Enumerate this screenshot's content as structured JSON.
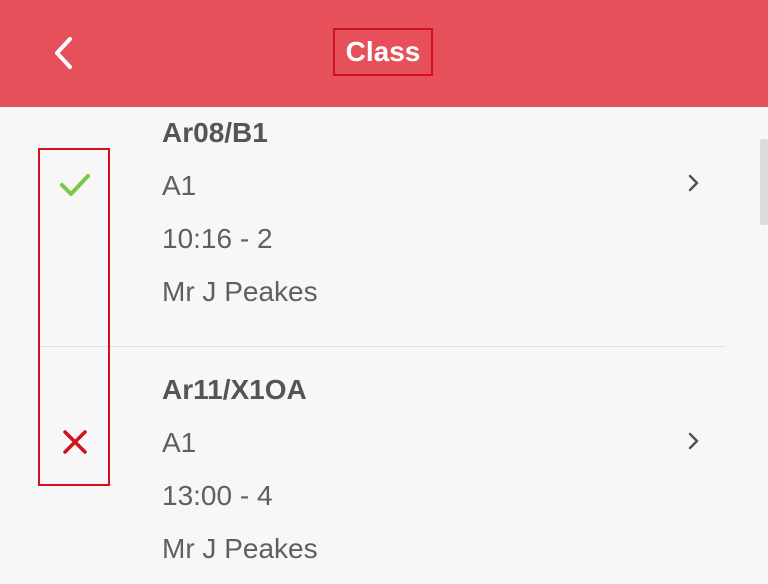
{
  "header": {
    "title": "Class",
    "back_icon": "chevron-left-icon",
    "background": "#e5505a"
  },
  "classes": [
    {
      "code": "Ar08/B1",
      "room": "A1",
      "time": "10:16 - 2",
      "teacher": "Mr J Peakes",
      "status": "present",
      "status_icon": "check-icon",
      "status_color": "#7ac943"
    },
    {
      "code": "Ar11/X1OA",
      "room": "A1",
      "time": "13:00 - 4",
      "teacher": "Mr J Peakes",
      "status": "absent",
      "status_icon": "cross-icon",
      "status_color": "#d0101a"
    }
  ]
}
